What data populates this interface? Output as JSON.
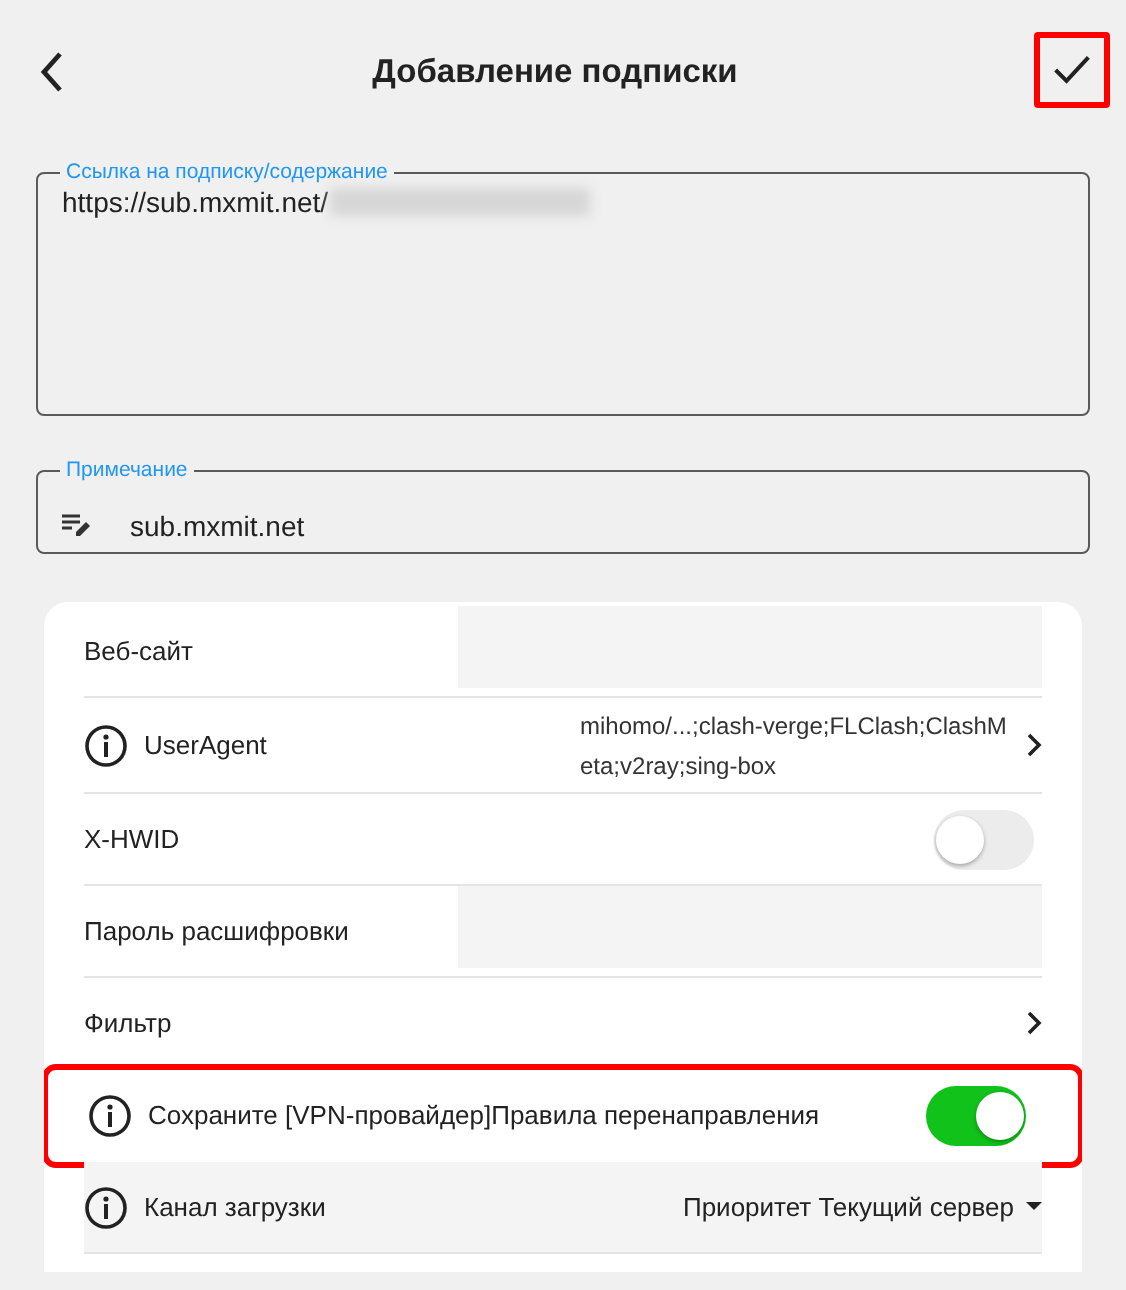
{
  "header": {
    "title": "Добавление подписки",
    "confirm_highlighted": true
  },
  "fields": [
    {
      "kind": "multiline",
      "label": "Ссылка на подписку/содержание",
      "value": "https://sub.mxmit.net/",
      "redacted": true
    },
    {
      "kind": "note",
      "label": "Примечание",
      "value": "sub.mxmit.net"
    }
  ],
  "settings": [
    {
      "kind": "input",
      "label": "Веб-сайт",
      "info": false
    },
    {
      "kind": "link",
      "label": "UserAgent",
      "info": true,
      "value": "mihomo/...;clash-verge;FLClash;ClashMeta;v2ray;sing-box"
    },
    {
      "kind": "toggle",
      "label": "X-HWID",
      "info": false,
      "on": false
    },
    {
      "kind": "input",
      "label": "Пароль расшифровки",
      "info": false
    },
    {
      "kind": "link",
      "label": "Фильтр",
      "info": false
    },
    {
      "kind": "toggle",
      "label": "Сохраните [VPN-провайдер]Правила перенаправления",
      "info": true,
      "on": true,
      "highlighted": true
    },
    {
      "kind": "dropdown",
      "label": "Канал загрузки",
      "info": true,
      "value": "Приоритет Текущий сервер"
    }
  ]
}
